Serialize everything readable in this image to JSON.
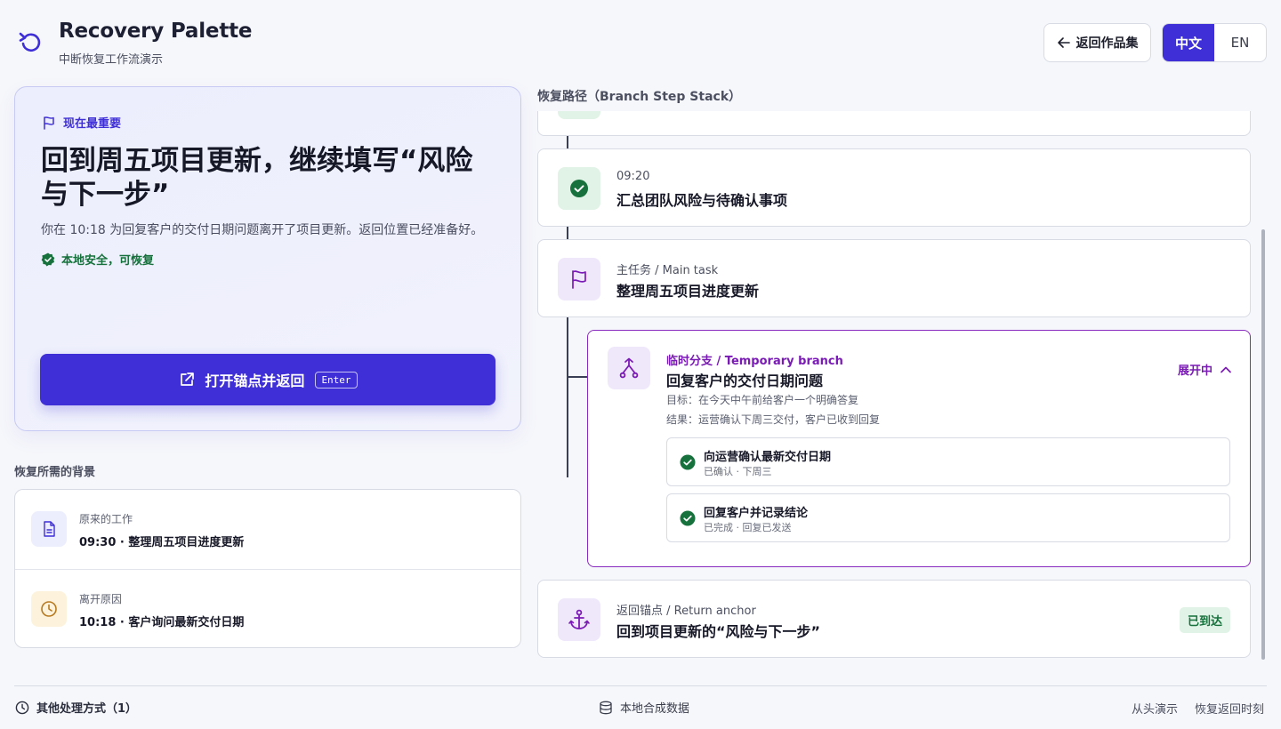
{
  "app": {
    "title": "Recovery Palette",
    "subtitle": "中断恢复工作流演示"
  },
  "header": {
    "back_label": "返回作品集",
    "lang_options": [
      "中文",
      "EN"
    ],
    "lang_selected": "中文"
  },
  "hero": {
    "tag": "现在最重要",
    "title": "回到周五项目更新，继续填写“风险与下一步”",
    "description": "你在 10:18 为回复客户的交付日期问题离开了项目更新。返回位置已经准备好。",
    "safe_status": "本地安全，可恢复",
    "primary_button": "打开锚点并返回",
    "shortcut": "Enter"
  },
  "context": {
    "label": "恢复所需的背景",
    "items": [
      {
        "key": "原来的工作",
        "value": "09:30 · 整理周五项目进度更新",
        "icon": "document-icon"
      },
      {
        "key": "离开原因",
        "value": "10:18 · 客户询问最新交付日期",
        "icon": "clock-icon"
      }
    ]
  },
  "timeline": {
    "label": "恢复路径（Branch Step Stack）",
    "step_done": {
      "time": "09:20",
      "title": "汇总团队风险与待确认事项"
    },
    "main_task": {
      "kind": "主任务 / Main task",
      "title": "整理周五项目进度更新"
    },
    "branch": {
      "kind": "临时分支 / Temporary branch",
      "title": "回复客户的交付日期问题",
      "goal": "目标：在今天中午前给客户一个明确答复",
      "result": "结果：运营确认下周三交付，客户已收到回复",
      "state": "展开中",
      "substeps": [
        {
          "title": "向运营确认最新交付日期",
          "status": "已确认 · 下周三"
        },
        {
          "title": "回复客户并记录结论",
          "status": "已完成 · 回复已发送"
        }
      ]
    },
    "anchor": {
      "kind": "返回锚点 / Return anchor",
      "title": "回到项目更新的“风险与下一步”",
      "badge": "已到达"
    }
  },
  "footer": {
    "other_methods": "其他处理方式（1）",
    "data_source": "本地合成数据",
    "link_replay": "从头演示",
    "link_restore": "恢复返回时刻"
  },
  "colors": {
    "accent": "#3f2fd6",
    "branch": "#7b1bb5",
    "success": "#16713c",
    "warning": "#b7791f"
  }
}
